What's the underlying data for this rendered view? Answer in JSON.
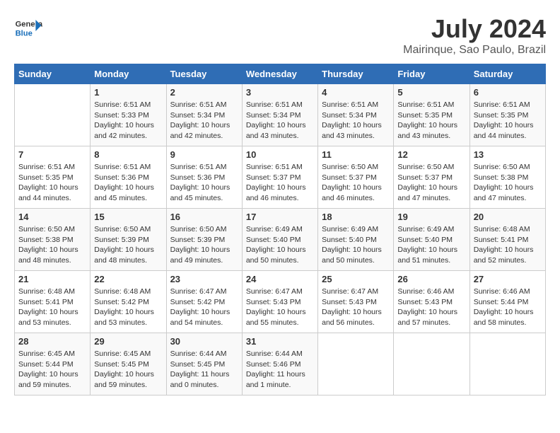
{
  "header": {
    "logo_general": "General",
    "logo_blue": "Blue",
    "month_title": "July 2024",
    "location": "Mairinque, Sao Paulo, Brazil"
  },
  "weekdays": [
    "Sunday",
    "Monday",
    "Tuesday",
    "Wednesday",
    "Thursday",
    "Friday",
    "Saturday"
  ],
  "weeks": [
    [
      {
        "day": "",
        "info": ""
      },
      {
        "day": "1",
        "info": "Sunrise: 6:51 AM\nSunset: 5:33 PM\nDaylight: 10 hours\nand 42 minutes."
      },
      {
        "day": "2",
        "info": "Sunrise: 6:51 AM\nSunset: 5:34 PM\nDaylight: 10 hours\nand 42 minutes."
      },
      {
        "day": "3",
        "info": "Sunrise: 6:51 AM\nSunset: 5:34 PM\nDaylight: 10 hours\nand 43 minutes."
      },
      {
        "day": "4",
        "info": "Sunrise: 6:51 AM\nSunset: 5:34 PM\nDaylight: 10 hours\nand 43 minutes."
      },
      {
        "day": "5",
        "info": "Sunrise: 6:51 AM\nSunset: 5:35 PM\nDaylight: 10 hours\nand 43 minutes."
      },
      {
        "day": "6",
        "info": "Sunrise: 6:51 AM\nSunset: 5:35 PM\nDaylight: 10 hours\nand 44 minutes."
      }
    ],
    [
      {
        "day": "7",
        "info": "Sunrise: 6:51 AM\nSunset: 5:35 PM\nDaylight: 10 hours\nand 44 minutes."
      },
      {
        "day": "8",
        "info": "Sunrise: 6:51 AM\nSunset: 5:36 PM\nDaylight: 10 hours\nand 45 minutes."
      },
      {
        "day": "9",
        "info": "Sunrise: 6:51 AM\nSunset: 5:36 PM\nDaylight: 10 hours\nand 45 minutes."
      },
      {
        "day": "10",
        "info": "Sunrise: 6:51 AM\nSunset: 5:37 PM\nDaylight: 10 hours\nand 46 minutes."
      },
      {
        "day": "11",
        "info": "Sunrise: 6:50 AM\nSunset: 5:37 PM\nDaylight: 10 hours\nand 46 minutes."
      },
      {
        "day": "12",
        "info": "Sunrise: 6:50 AM\nSunset: 5:37 PM\nDaylight: 10 hours\nand 47 minutes."
      },
      {
        "day": "13",
        "info": "Sunrise: 6:50 AM\nSunset: 5:38 PM\nDaylight: 10 hours\nand 47 minutes."
      }
    ],
    [
      {
        "day": "14",
        "info": "Sunrise: 6:50 AM\nSunset: 5:38 PM\nDaylight: 10 hours\nand 48 minutes."
      },
      {
        "day": "15",
        "info": "Sunrise: 6:50 AM\nSunset: 5:39 PM\nDaylight: 10 hours\nand 48 minutes."
      },
      {
        "day": "16",
        "info": "Sunrise: 6:50 AM\nSunset: 5:39 PM\nDaylight: 10 hours\nand 49 minutes."
      },
      {
        "day": "17",
        "info": "Sunrise: 6:49 AM\nSunset: 5:40 PM\nDaylight: 10 hours\nand 50 minutes."
      },
      {
        "day": "18",
        "info": "Sunrise: 6:49 AM\nSunset: 5:40 PM\nDaylight: 10 hours\nand 50 minutes."
      },
      {
        "day": "19",
        "info": "Sunrise: 6:49 AM\nSunset: 5:40 PM\nDaylight: 10 hours\nand 51 minutes."
      },
      {
        "day": "20",
        "info": "Sunrise: 6:48 AM\nSunset: 5:41 PM\nDaylight: 10 hours\nand 52 minutes."
      }
    ],
    [
      {
        "day": "21",
        "info": "Sunrise: 6:48 AM\nSunset: 5:41 PM\nDaylight: 10 hours\nand 53 minutes."
      },
      {
        "day": "22",
        "info": "Sunrise: 6:48 AM\nSunset: 5:42 PM\nDaylight: 10 hours\nand 53 minutes."
      },
      {
        "day": "23",
        "info": "Sunrise: 6:47 AM\nSunset: 5:42 PM\nDaylight: 10 hours\nand 54 minutes."
      },
      {
        "day": "24",
        "info": "Sunrise: 6:47 AM\nSunset: 5:43 PM\nDaylight: 10 hours\nand 55 minutes."
      },
      {
        "day": "25",
        "info": "Sunrise: 6:47 AM\nSunset: 5:43 PM\nDaylight: 10 hours\nand 56 minutes."
      },
      {
        "day": "26",
        "info": "Sunrise: 6:46 AM\nSunset: 5:43 PM\nDaylight: 10 hours\nand 57 minutes."
      },
      {
        "day": "27",
        "info": "Sunrise: 6:46 AM\nSunset: 5:44 PM\nDaylight: 10 hours\nand 58 minutes."
      }
    ],
    [
      {
        "day": "28",
        "info": "Sunrise: 6:45 AM\nSunset: 5:44 PM\nDaylight: 10 hours\nand 59 minutes."
      },
      {
        "day": "29",
        "info": "Sunrise: 6:45 AM\nSunset: 5:45 PM\nDaylight: 10 hours\nand 59 minutes."
      },
      {
        "day": "30",
        "info": "Sunrise: 6:44 AM\nSunset: 5:45 PM\nDaylight: 11 hours\nand 0 minutes."
      },
      {
        "day": "31",
        "info": "Sunrise: 6:44 AM\nSunset: 5:46 PM\nDaylight: 11 hours\nand 1 minute."
      },
      {
        "day": "",
        "info": ""
      },
      {
        "day": "",
        "info": ""
      },
      {
        "day": "",
        "info": ""
      }
    ]
  ]
}
